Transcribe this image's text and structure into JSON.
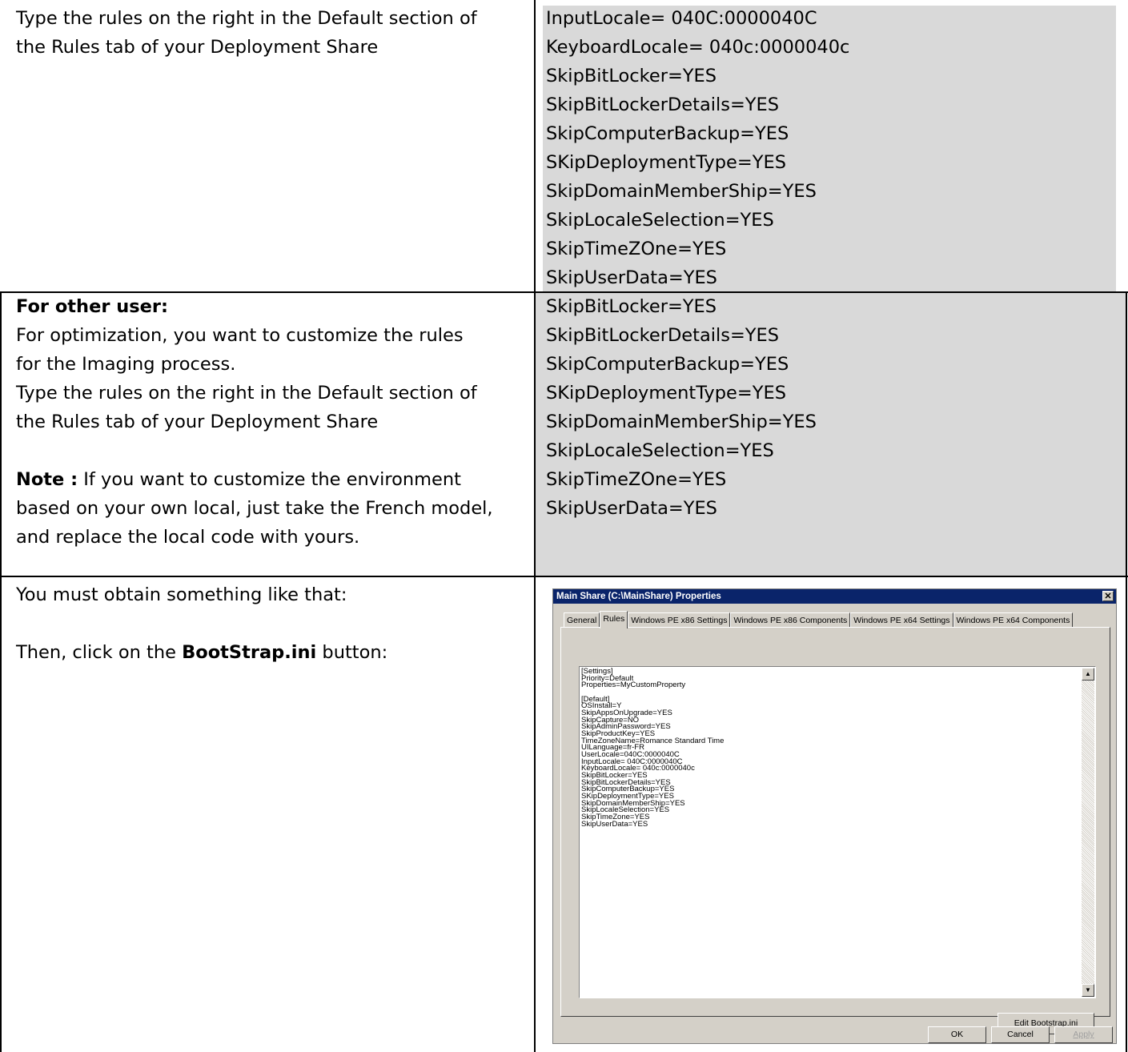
{
  "rows": [
    {
      "left": {
        "paragraphs": [
          "Type the rules on the right in the Default section of",
          "the Rules tab of your Deployment Share"
        ]
      },
      "right": {
        "lines": [
          "InputLocale= 040C:0000040C",
          "KeyboardLocale= 040c:0000040c",
          "SkipBitLocker=YES",
          "SkipBitLockerDetails=YES",
          "SkipComputerBackup=YES",
          "SKipDeploymentType=YES",
          "SkipDomainMemberShip=YES",
          "SkipLocaleSelection=YES",
          "SkipTimeZOne=YES",
          "SkipUserData=YES"
        ]
      }
    },
    {
      "left": {
        "heading": "For other user:",
        "lines": [
          "For optimization, you want to customize the rules",
          "for the Imaging process.",
          "Type the rules on the right in the Default section of",
          "the Rules tab of your Deployment Share"
        ],
        "note_label": "Note :",
        "note_lines": [
          " If you want to customize the environment",
          "based on your own local, just take the French model,",
          "and replace the local code with yours."
        ]
      },
      "right": {
        "lines": [
          "SkipBitLocker=YES",
          "SkipBitLockerDetails=YES",
          "SkipComputerBackup=YES",
          "SKipDeploymentType=YES",
          "SkipDomainMemberShip=YES",
          "SkipLocaleSelection=YES",
          "SkipTimeZOne=YES",
          "SkipUserData=YES"
        ]
      }
    },
    {
      "left": {
        "line1": "You must obtain something like that:",
        "line2_prefix": "Then, click on the ",
        "line2_bold": "BootStrap.ini",
        "line2_suffix": " button:"
      }
    }
  ],
  "dialog": {
    "title": "Main Share (C:\\MainShare) Properties",
    "close_glyph": "✕",
    "tabs": [
      "General",
      "Rules",
      "Windows PE x86 Settings",
      "Windows PE x86 Components",
      "Windows PE x64 Settings",
      "Windows PE x64 Components"
    ],
    "active_tab": "Rules",
    "rules_text": "[Settings]\nPriority=Default\nProperties=MyCustomProperty\n\n[Default]\nOSInstall=Y\nSkipAppsOnUpgrade=YES\nSkipCapture=NO\nSkipAdminPassword=YES\nSkipProductKey=YES\nTimeZoneName=Romance Standard Time\nUILanguage=fr-FR\nUserLocale=040C:0000040C\nInputLocale= 040C:0000040C\nKeyboardLocale= 040c:0000040c\nSkipBitLocker=YES\nSkipBitLockerDetails=YES\nSkipComputerBackup=YES\nSKipDeploymentType=YES\nSkipDomainMemberShip=YES\nSkipLocaleSelection=YES\nSkipTimeZone=YES\nSkipUserData=YES",
    "edit_button": "Edit Bootstrap.ini",
    "ok_button": "OK",
    "cancel_button": "Cancel",
    "apply_button": "Apply",
    "scroll_up_glyph": "▲",
    "scroll_down_glyph": "▼"
  }
}
